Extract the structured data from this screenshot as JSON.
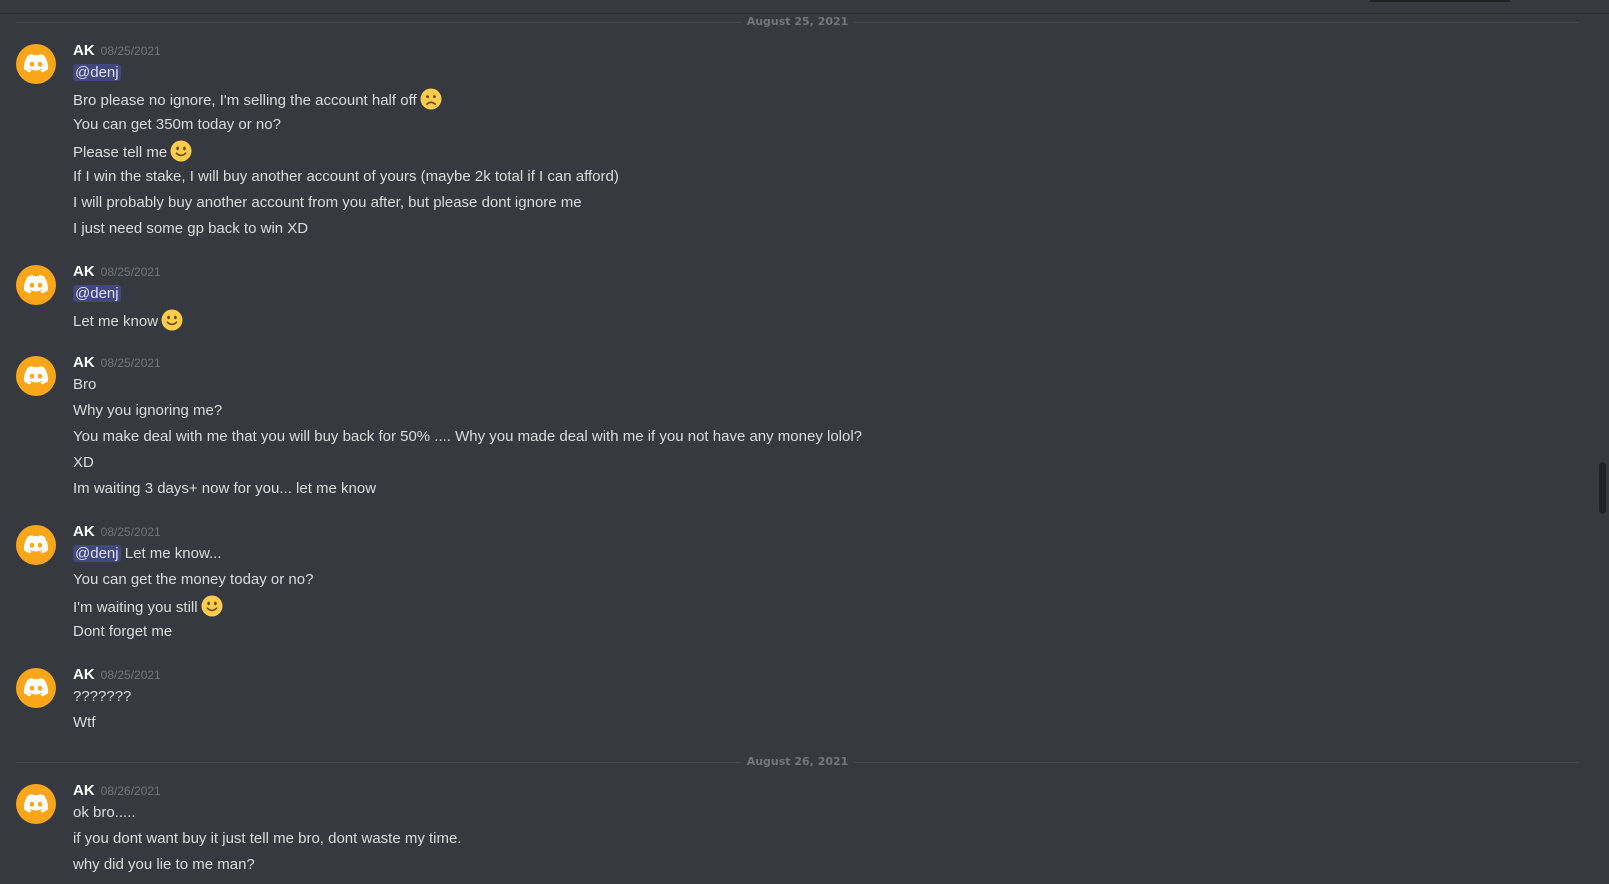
{
  "dividers": [
    "August 25, 2021",
    "August 26, 2021"
  ],
  "mention_handle": "@denj",
  "messages": [
    {
      "author": "AK",
      "timestamp": "08/25/2021",
      "lines": [
        "Bro please no ignore, I'm selling the account half off",
        "You can get 350m today or no?",
        "Please tell me",
        "If I win the stake, I will buy another account of yours (maybe 2k total if I can afford)",
        "I will probably buy another account from you after, but please dont ignore me",
        "I just need some gp back to win XD"
      ]
    },
    {
      "author": "AK",
      "timestamp": "08/25/2021",
      "lines": [
        "Let me know"
      ]
    },
    {
      "author": "AK",
      "timestamp": "08/25/2021",
      "lines": [
        "Bro",
        "Why you ignoring me?",
        "You make deal with me that you will buy back for 50% .... Why you made deal with me if you not have any money lolol?",
        "XD",
        "Im waiting 3 days+ now for you... let me know"
      ]
    },
    {
      "author": "AK",
      "timestamp": "08/25/2021",
      "mention_suffix": "Let me know...",
      "lines": [
        "You can get the money today or no?",
        "I'm waiting you still",
        "Dont forget me"
      ]
    },
    {
      "author": "AK",
      "timestamp": "08/25/2021",
      "lines": [
        "???????",
        "Wtf"
      ]
    },
    {
      "author": "AK",
      "timestamp": "08/26/2021",
      "lines": [
        "ok bro.....",
        "if you dont want buy it just tell me bro, dont waste my time.",
        "why did you lie to me man?"
      ]
    }
  ],
  "emojis": {
    "frown": "frowning-face-emoji",
    "smile": "slightly-smiling-face-emoji"
  },
  "colors": {
    "background": "#36393f",
    "avatar": "#faa61a",
    "mention_bg": "#4a4f8a",
    "text": "#dcddde",
    "muted": "#72767d",
    "emoji": "#ffcc4d"
  }
}
